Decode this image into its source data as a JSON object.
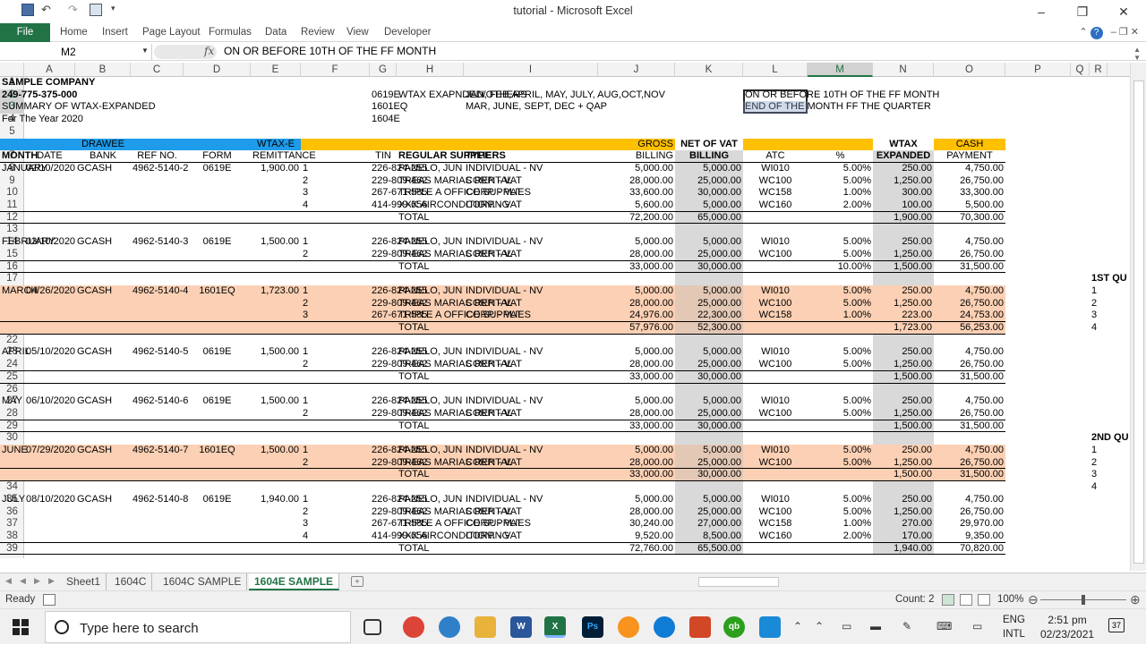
{
  "window": {
    "title": "tutorial - Microsoft Excel",
    "controls": [
      "–",
      "❐",
      "✕"
    ]
  },
  "ribbon": {
    "file": "File",
    "tabs": [
      "Home",
      "Insert",
      "Page Layout",
      "Formulas",
      "Data",
      "Review",
      "View",
      "Developer"
    ],
    "help": "?"
  },
  "formula_bar": {
    "name_box": "M2",
    "fx": "fx",
    "formula": "ON OR BEFORE 10TH OF THE FF MONTH"
  },
  "columns": [
    "A",
    "B",
    "C",
    "D",
    "E",
    "F",
    "G",
    "H",
    "I",
    "J",
    "K",
    "L",
    "M",
    "N",
    "O",
    "P",
    "Q",
    "R"
  ],
  "selected_column": "M",
  "selected_rows": [
    "2",
    "3"
  ],
  "rows": [
    "1",
    "2",
    "3",
    "4",
    "5",
    "6",
    "7",
    "8",
    "9",
    "10",
    "11",
    "12",
    "13",
    "14",
    "15",
    "16",
    "17",
    "18",
    "19",
    "20",
    "21",
    "22",
    "23",
    "24",
    "25",
    "26",
    "27",
    "28",
    "29",
    "30",
    "31",
    "32",
    "33",
    "34",
    "35",
    "36",
    "37",
    "38",
    "39"
  ],
  "header_block": {
    "company": "SAMPLE COMPANY",
    "tin": "249-775-375-000",
    "summary": "SUMMARY OF WTAX-EXPANDED",
    "year": "For The Year 2020",
    "form_codes": [
      "0619E",
      "1601EQ",
      "1604E"
    ],
    "wtax_label": "WTAX EXAPNDED/OTHERS",
    "months_line1": "JAN, FEB,APRIL, MAY, JULY, AUG,OCT,NOV",
    "months_line2": "MAR, JUNE, SEPT, DEC + QAP",
    "deadline1": "ON OR BEFORE 10TH OF THE FF MONTH",
    "deadline2": "END OF THE MONTH FF THE QUARTER"
  },
  "table_headers": {
    "drawee_top": "DRAWEE",
    "wtaxe_top": "WTAX-E",
    "gross_top": "GROSS",
    "netvat_top": "NET OF VAT",
    "wtax_top": "WTAX",
    "cash_top": "CASH",
    "month": "MONTH",
    "date": "DATE",
    "bank": "BANK",
    "ref": "REF NO.",
    "form": "FORM",
    "remit": "REMITTANCE",
    "tin": "TIN",
    "suppliers": "REGULAR SUPPLIERS",
    "type": "TYPE",
    "billing": "BILLING",
    "netbilling": "BILLING",
    "atc": "ATC",
    "pct": "%",
    "expanded": "EXPANDED",
    "payment": "PAYMENT"
  },
  "months": [
    {
      "name": "JANUARY",
      "date": "02/10/2020",
      "bank": "GCASH",
      "ref": "4962-5140-2",
      "form": "0619E",
      "remit": "1,900.00",
      "total": {
        "label": "TOTAL",
        "gross": "72,200.00",
        "net": "65,000.00",
        "pct": "",
        "wtax": "1,900.00",
        "cash": "70,300.00"
      },
      "lines": [
        {
          "n": "1",
          "tin": "226-824-255",
          "sup": "PANELO, JUN",
          "type": "INDIVIDUAL - NV",
          "gross": "5,000.00",
          "net": "5,000.00",
          "atc": "WI010",
          "pct": "5.00%",
          "wtax": "250.00",
          "cash": "4,750.00"
        },
        {
          "n": "2",
          "tin": "229-809-462",
          "sup": "TREAS MARIAS RENTAL",
          "type": "CORP. - VAT",
          "gross": "28,000.00",
          "net": "25,000.00",
          "atc": "WC100",
          "pct": "5.00%",
          "wtax": "1,250.00",
          "cash": "26,750.00"
        },
        {
          "n": "3",
          "tin": "267-671-585",
          "sup": "TRIPLE A OFFICE SUPPLIES",
          "type": "CORP. - VAT",
          "gross": "33,600.00",
          "net": "30,000.00",
          "atc": "WC158",
          "pct": "1.00%",
          "wtax": "300.00",
          "cash": "33,300.00"
        },
        {
          "n": "4",
          "tin": "414-999-656",
          "sup": "XXX AIRCONDITIONING",
          "type": "CORP. - VAT",
          "gross": "5,600.00",
          "net": "5,000.00",
          "atc": "WC160",
          "pct": "2.00%",
          "wtax": "100.00",
          "cash": "5,500.00"
        }
      ]
    },
    {
      "name": "FEBRUARY",
      "date": "03/10/2020",
      "bank": "GCASH",
      "ref": "4962-5140-3",
      "form": "0619E",
      "remit": "1,500.00",
      "total": {
        "label": "TOTAL",
        "gross": "33,000.00",
        "net": "30,000.00",
        "pct": "10.00%",
        "wtax": "1,500.00",
        "cash": "31,500.00"
      },
      "lines": [
        {
          "n": "1",
          "tin": "226-824-255",
          "sup": "PANELO, JUN",
          "type": "INDIVIDUAL - NV",
          "gross": "5,000.00",
          "net": "5,000.00",
          "atc": "WI010",
          "pct": "5.00%",
          "wtax": "250.00",
          "cash": "4,750.00"
        },
        {
          "n": "2",
          "tin": "229-809-462",
          "sup": "TREAS MARIAS RENTAL",
          "type": "CORP. - VAT",
          "gross": "28,000.00",
          "net": "25,000.00",
          "atc": "WC100",
          "pct": "5.00%",
          "wtax": "1,250.00",
          "cash": "26,750.00"
        }
      ]
    },
    {
      "name": "MARCH",
      "date": "04/26/2020",
      "bank": "GCASH",
      "ref": "4962-5140-4",
      "form": "1601EQ",
      "remit": "1,723.00",
      "total": {
        "label": "TOTAL",
        "gross": "57,976.00",
        "net": "52,300.00",
        "pct": "",
        "wtax": "1,723.00",
        "cash": "56,253.00"
      },
      "lines": [
        {
          "n": "1",
          "tin": "226-824-255",
          "sup": "PANELO, JUN",
          "type": "INDIVIDUAL - NV",
          "gross": "5,000.00",
          "net": "5,000.00",
          "atc": "WI010",
          "pct": "5.00%",
          "wtax": "250.00",
          "cash": "4,750.00"
        },
        {
          "n": "2",
          "tin": "229-809-462",
          "sup": "TREAS MARIAS RENTAL",
          "type": "CORP. - VAT",
          "gross": "28,000.00",
          "net": "25,000.00",
          "atc": "WC100",
          "pct": "5.00%",
          "wtax": "1,250.00",
          "cash": "26,750.00"
        },
        {
          "n": "3",
          "tin": "267-671-585",
          "sup": "TRIPLE A OFFICE SUPPLIES",
          "type": "CORP. - VAT",
          "gross": "24,976.00",
          "net": "22,300.00",
          "atc": "WC158",
          "pct": "1.00%",
          "wtax": "223.00",
          "cash": "24,753.00"
        }
      ]
    },
    {
      "name": "APRIL",
      "date": "05/10/2020",
      "bank": "GCASH",
      "ref": "4962-5140-5",
      "form": "0619E",
      "remit": "1,500.00",
      "total": {
        "label": "TOTAL",
        "gross": "33,000.00",
        "net": "30,000.00",
        "pct": "",
        "wtax": "1,500.00",
        "cash": "31,500.00"
      },
      "lines": [
        {
          "n": "1",
          "tin": "226-824-255",
          "sup": "PANELO, JUN",
          "type": "INDIVIDUAL - NV",
          "gross": "5,000.00",
          "net": "5,000.00",
          "atc": "WI010",
          "pct": "5.00%",
          "wtax": "250.00",
          "cash": "4,750.00"
        },
        {
          "n": "2",
          "tin": "229-809-462",
          "sup": "TREAS MARIAS RENTAL",
          "type": "CORP. - VAT",
          "gross": "28,000.00",
          "net": "25,000.00",
          "atc": "WC100",
          "pct": "5.00%",
          "wtax": "1,250.00",
          "cash": "26,750.00"
        }
      ]
    },
    {
      "name": "MAY",
      "date": "06/10/2020",
      "bank": "GCASH",
      "ref": "4962-5140-6",
      "form": "0619E",
      "remit": "1,500.00",
      "total": {
        "label": "TOTAL",
        "gross": "33,000.00",
        "net": "30,000.00",
        "pct": "",
        "wtax": "1,500.00",
        "cash": "31,500.00"
      },
      "lines": [
        {
          "n": "1",
          "tin": "226-824-255",
          "sup": "PANELO, JUN",
          "type": "INDIVIDUAL - NV",
          "gross": "5,000.00",
          "net": "5,000.00",
          "atc": "WI010",
          "pct": "5.00%",
          "wtax": "250.00",
          "cash": "4,750.00"
        },
        {
          "n": "2",
          "tin": "229-809-462",
          "sup": "TREAS MARIAS RENTAL",
          "type": "CORP. - VAT",
          "gross": "28,000.00",
          "net": "25,000.00",
          "atc": "WC100",
          "pct": "5.00%",
          "wtax": "1,250.00",
          "cash": "26,750.00"
        }
      ]
    },
    {
      "name": "JUNE",
      "date": "07/29/2020",
      "bank": "GCASH",
      "ref": "4962-5140-7",
      "form": "1601EQ",
      "remit": "1,500.00",
      "total": {
        "label": "TOTAL",
        "gross": "33,000.00",
        "net": "30,000.00",
        "pct": "",
        "wtax": "1,500.00",
        "cash": "31,500.00"
      },
      "lines": [
        {
          "n": "1",
          "tin": "226-824-255",
          "sup": "PANELO, JUN",
          "type": "INDIVIDUAL - NV",
          "gross": "5,000.00",
          "net": "5,000.00",
          "atc": "WI010",
          "pct": "5.00%",
          "wtax": "250.00",
          "cash": "4,750.00"
        },
        {
          "n": "2",
          "tin": "229-809-462",
          "sup": "TREAS MARIAS RENTAL",
          "type": "CORP. - VAT",
          "gross": "28,000.00",
          "net": "25,000.00",
          "atc": "WC100",
          "pct": "5.00%",
          "wtax": "1,250.00",
          "cash": "26,750.00"
        }
      ]
    },
    {
      "name": "JULY",
      "date": "08/10/2020",
      "bank": "GCASH",
      "ref": "4962-5140-8",
      "form": "0619E",
      "remit": "1,940.00",
      "total": {
        "label": "TOTAL",
        "gross": "72,760.00",
        "net": "65,500.00",
        "pct": "",
        "wtax": "1,940.00",
        "cash": "70,820.00"
      },
      "lines": [
        {
          "n": "1",
          "tin": "226-824-255",
          "sup": "PANELO, JUN",
          "type": "INDIVIDUAL - NV",
          "gross": "5,000.00",
          "net": "5,000.00",
          "atc": "WI010",
          "pct": "5.00%",
          "wtax": "250.00",
          "cash": "4,750.00"
        },
        {
          "n": "2",
          "tin": "229-809-462",
          "sup": "TREAS MARIAS RENTAL",
          "type": "CORP. - VAT",
          "gross": "28,000.00",
          "net": "25,000.00",
          "atc": "WC100",
          "pct": "5.00%",
          "wtax": "1,250.00",
          "cash": "26,750.00"
        },
        {
          "n": "3",
          "tin": "267-671-585",
          "sup": "TRIPLE A OFFICE SUPPLIES",
          "type": "CORP. - VAT",
          "gross": "30,240.00",
          "net": "27,000.00",
          "atc": "WC158",
          "pct": "1.00%",
          "wtax": "270.00",
          "cash": "29,970.00"
        },
        {
          "n": "4",
          "tin": "414-999-656",
          "sup": "XXX AIRCONDITIONING",
          "type": "CORP. - VAT",
          "gross": "9,520.00",
          "net": "8,500.00",
          "atc": "WC160",
          "pct": "2.00%",
          "wtax": "170.00",
          "cash": "9,350.00"
        }
      ]
    }
  ],
  "side_labels": [
    {
      "title": "1ST QU",
      "items": [
        "1",
        "2",
        "3",
        "4"
      ]
    },
    {
      "title": "2ND QU",
      "items": [
        "1",
        "2",
        "3",
        "4"
      ]
    }
  ],
  "sheet_tabs": [
    "Sheet1",
    "1604C",
    "1604C SAMPLE",
    "1604E SAMPLE"
  ],
  "active_tab": "1604E SAMPLE",
  "status": {
    "ready": "Ready",
    "count": "Count: 2",
    "zoom": "100%"
  },
  "taskbar": {
    "search_placeholder": "Type here to search",
    "lang1": "ENG",
    "lang2": "INTL",
    "time": "2:51 pm",
    "date": "02/23/2021",
    "notifications": "37"
  },
  "colors": {
    "excel_green": "#217346",
    "blue_band": "#1e9bea",
    "orange_band": "#ffc000",
    "peach_fill": "#fbd0b4",
    "gray_col": "#d9d9d9",
    "pink_side": "#f2c7cc"
  }
}
